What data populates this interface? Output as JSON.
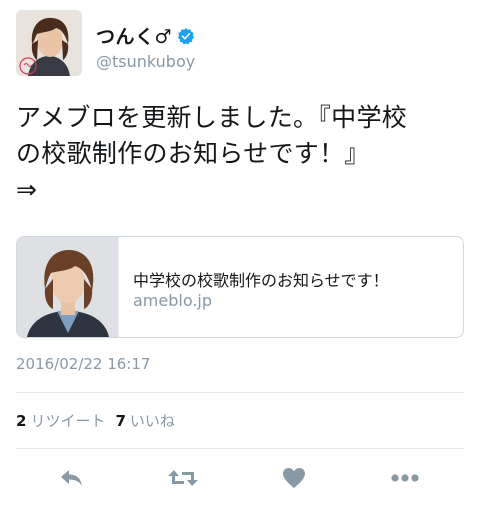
{
  "author": {
    "display_name": "つんく♂",
    "handle": "@tsunkuboy",
    "verified": true
  },
  "tweet": {
    "lines": [
      "アメブロを更新しました。『中学校",
      "の校歌制作のお知らせです！』",
      "⇒"
    ]
  },
  "card": {
    "title": "中学校の校歌制作のお知らせです！",
    "domain": "ameblo.jp"
  },
  "timestamp": "2016/02/22 16:17",
  "stats": {
    "retweets_count": "2",
    "retweets_label": "リツイート",
    "likes_count": "7",
    "likes_label": "いいね"
  },
  "actions": [
    "reply-icon",
    "retweet-icon",
    "like-heart-icon",
    "more-dots-icon"
  ],
  "colors": {
    "text": "#14171a",
    "secondary": "#8899a6",
    "icon": "#8899a6",
    "verified": "#1da1f2",
    "border": "#e1e8ed"
  }
}
